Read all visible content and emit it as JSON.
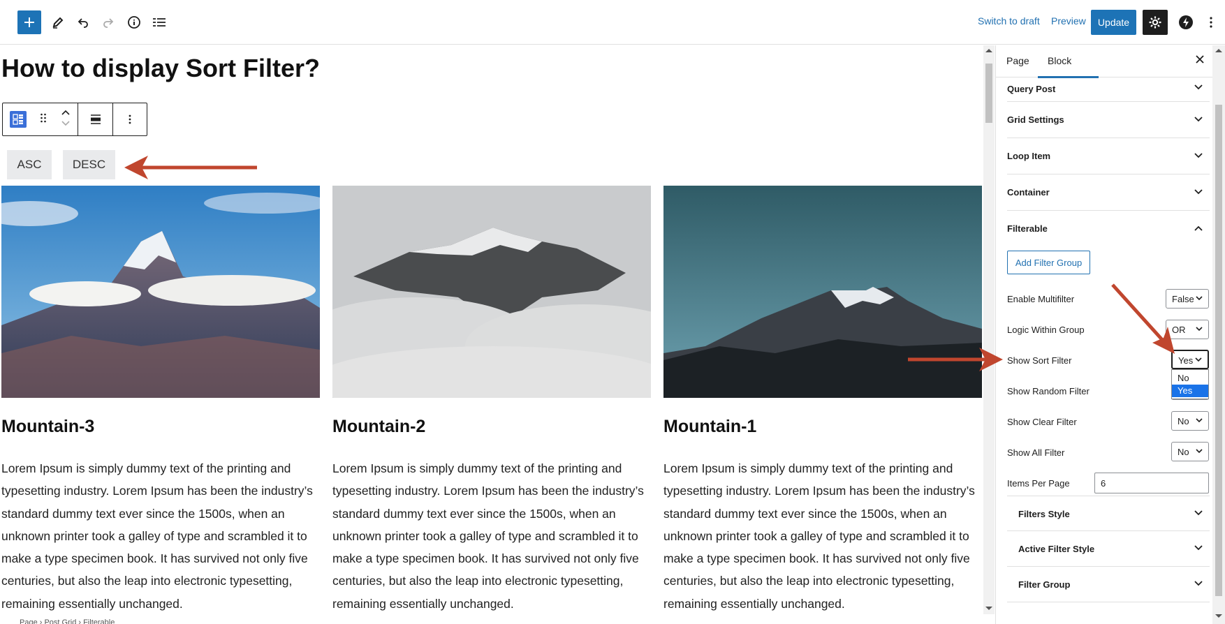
{
  "toolbar": {
    "switch_to_draft": "Switch to draft",
    "preview": "Preview",
    "update": "Update"
  },
  "editor": {
    "page_title": "How to display Sort Filter?",
    "sort_buttons": [
      "ASC",
      "DESC"
    ],
    "cards": [
      {
        "title": "Mountain-3",
        "text": "Lorem Ipsum is simply dummy text of the printing and typesetting industry. Lorem Ipsum has been the industry’s standard dummy text ever since the 1500s, when an unknown printer took a galley of type and scrambled it to make a type specimen book. It has survived not only five centuries, but also the leap into electronic typesetting, remaining essentially unchanged."
      },
      {
        "title": "Mountain-2",
        "text": "Lorem Ipsum is simply dummy text of the printing and typesetting industry. Lorem Ipsum has been the industry’s standard dummy text ever since the 1500s, when an unknown printer took a galley of type and scrambled it to make a type specimen book. It has survived not only five centuries, but also the leap into electronic typesetting, remaining essentially unchanged."
      },
      {
        "title": "Mountain-1",
        "text": "Lorem Ipsum is simply dummy text of the printing and typesetting industry. Lorem Ipsum has been the industry’s standard dummy text ever since the 1500s, when an unknown printer took a galley of type and scrambled it to make a type specimen book. It has survived not only five centuries, but also the leap into electronic typesetting, remaining essentially unchanged."
      }
    ]
  },
  "breadcrumb": "Page  ›  Post Grid  ›  Filterable",
  "sidebar": {
    "tabs": [
      "Page",
      "Block"
    ],
    "panels": [
      "Query Post",
      "Grid Settings",
      "Loop Item",
      "Container",
      "Filterable"
    ],
    "add_filter_group": "Add Filter Group",
    "controls": {
      "enable_multifilter": {
        "label": "Enable Multifilter",
        "value": "False"
      },
      "logic_within_group": {
        "label": "Logic Within Group",
        "value": "OR"
      },
      "show_sort_filter": {
        "label": "Show Sort Filter",
        "value": "Yes",
        "options": [
          "No",
          "Yes"
        ]
      },
      "show_random_filter": {
        "label": "Show Random Filter"
      },
      "show_clear_filter": {
        "label": "Show Clear Filter",
        "value": "No"
      },
      "show_all_filter": {
        "label": "Show All Filter",
        "value": "No"
      },
      "items_per_page": {
        "label": "Items Per Page",
        "value": "6"
      }
    },
    "sub_panels": [
      "Filters Style",
      "Active Filter Style",
      "Filter Group"
    ]
  },
  "colors": {
    "accent": "#1d73b6",
    "annotation_arrow": "#c0462e"
  }
}
